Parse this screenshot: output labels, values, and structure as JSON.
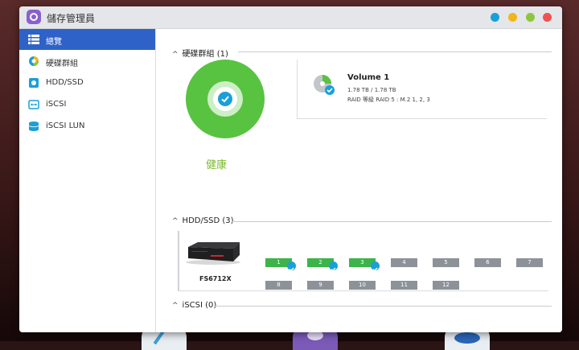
{
  "window": {
    "title": "儲存管理員"
  },
  "sidebar": {
    "items": [
      {
        "label": "總覽",
        "icon": "overview-icon",
        "active": true
      },
      {
        "label": "硬碟群組",
        "icon": "pie-chart-icon",
        "active": false
      },
      {
        "label": "HDD/SSD",
        "icon": "disk-icon",
        "active": false
      },
      {
        "label": "iSCSI",
        "icon": "iscsi-icon",
        "active": false
      },
      {
        "label": "iSCSI LUN",
        "icon": "database-icon",
        "active": false
      }
    ]
  },
  "main": {
    "disk_groups": {
      "heading": "硬碟群組 (1)",
      "health_label": "健康",
      "volume": {
        "name": "Volume 1",
        "size": "1.78 TB / 1.78 TB",
        "raid": "RAID 等級 RAID 5 : M.2 1, 2, 3"
      }
    },
    "hdd_ssd": {
      "heading": "HDD/SSD (3)",
      "device_label": "FS6712X",
      "slots": [
        {
          "label": "1",
          "used": true
        },
        {
          "label": "2",
          "used": true
        },
        {
          "label": "3",
          "used": true
        },
        {
          "label": "4",
          "used": false
        },
        {
          "label": "5",
          "used": false
        },
        {
          "label": "6",
          "used": false
        },
        {
          "label": "7",
          "used": false
        },
        {
          "label": "8",
          "used": false
        },
        {
          "label": "9",
          "used": false
        },
        {
          "label": "10",
          "used": false
        },
        {
          "label": "11",
          "used": false
        },
        {
          "label": "12",
          "used": false
        }
      ]
    },
    "iscsi": {
      "heading": "iSCSI (0)"
    }
  },
  "colors": {
    "accent": "#2f62c8",
    "health_green": "#58c341",
    "health_text": "#7cba2e",
    "check_blue": "#1a9fd9",
    "disk_used": "#3cb44a",
    "disk_empty": "#8d9299",
    "window_controls": [
      "#1a9fd9",
      "#f2b51c",
      "#8cc63f",
      "#f0504e"
    ]
  }
}
